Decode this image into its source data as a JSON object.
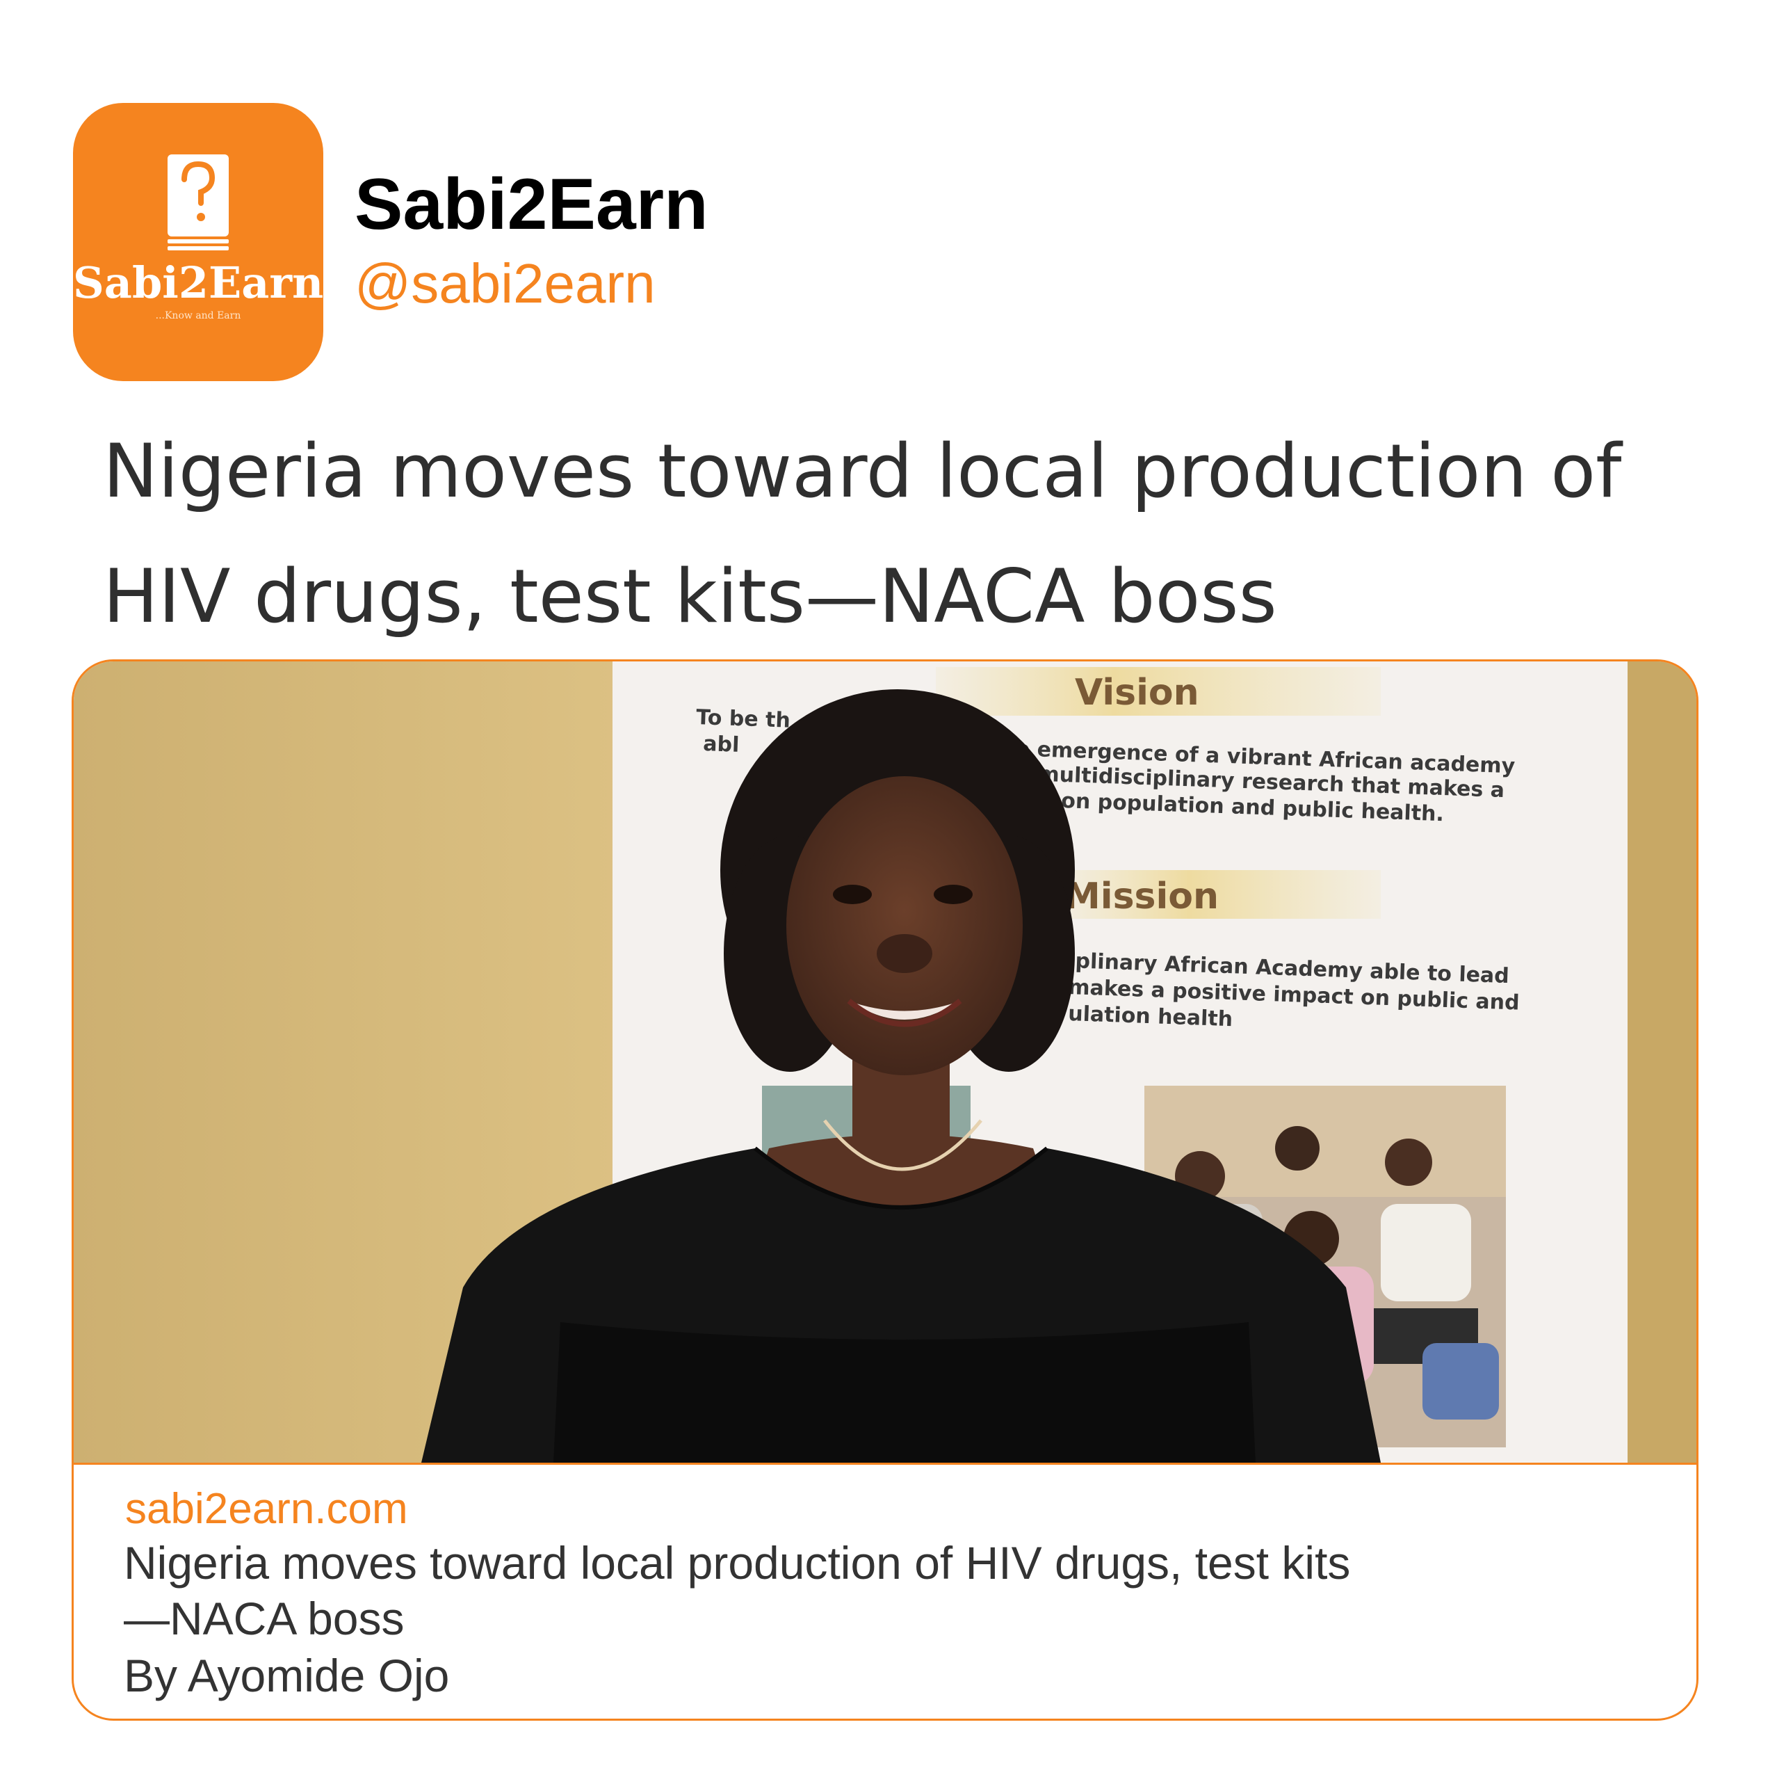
{
  "profile": {
    "name": "Sabi2Earn",
    "handle": "@sabi2earn",
    "avatar_logo_text": "Sabi2Earn",
    "avatar_logo_tagline": "...Know and Earn",
    "avatar_icon": "book-question-icon"
  },
  "headline": "Nigeria moves toward local production of HIV drugs, test kits—NACA boss",
  "card": {
    "domain": "sabi2earn.com",
    "title": "Nigeria moves toward local production of HIV drugs, test kits\n—NACA boss",
    "author": "By Ayomide Ojo",
    "poster": {
      "vision_heading": "Vision",
      "vision_lines": [
        "To be th",
        "for the emergence of a vibrant African academy",
        "abl",
        "ss multidisciplinary research that makes a",
        "on population and public health."
      ],
      "mission_heading": "Mission",
      "mission_lines": [
        "iplinary African Academy able to lead",
        "makes a positive impact on public and",
        "ulation health"
      ]
    }
  },
  "colors": {
    "accent": "#f5841f",
    "text_dark": "#2f2f2f"
  }
}
